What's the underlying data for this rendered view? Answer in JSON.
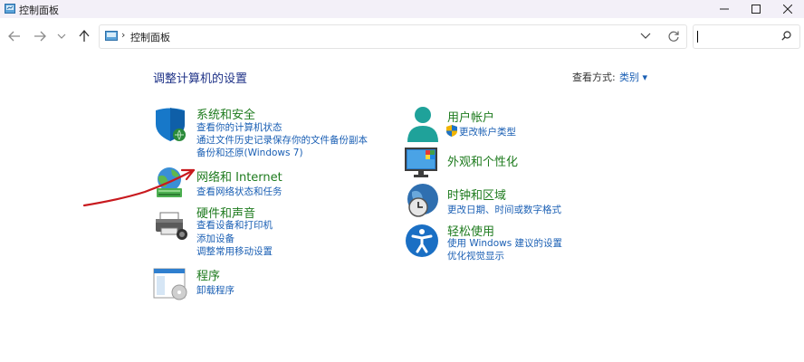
{
  "window": {
    "title": "控制面板"
  },
  "address": {
    "path": "控制面板",
    "separator": "›"
  },
  "search": {
    "placeholder": ""
  },
  "page": {
    "heading": "调整计算机的设置",
    "view_by_label": "查看方式:",
    "view_by_value": "类别 ▾"
  },
  "categories_left": [
    {
      "title": "系统和安全",
      "icon": "shield-icon",
      "links": [
        "查看你的计算机状态",
        "通过文件历史记录保存你的文件备份副本",
        "备份和还原(Windows 7)"
      ]
    },
    {
      "title": "网络和 Internet",
      "icon": "network-globe-icon",
      "links": [
        "查看网络状态和任务"
      ]
    },
    {
      "title": "硬件和声音",
      "icon": "printer-icon",
      "links": [
        "查看设备和打印机",
        "添加设备",
        "调整常用移动设置"
      ]
    },
    {
      "title": "程序",
      "icon": "programs-icon",
      "links": [
        "卸载程序"
      ]
    }
  ],
  "categories_right": [
    {
      "title": "用户帐户",
      "icon": "user-icon",
      "links": [
        "更改帐户类型"
      ]
    },
    {
      "title": "外观和个性化",
      "icon": "monitor-icon",
      "links": []
    },
    {
      "title": "时钟和区域",
      "icon": "clock-globe-icon",
      "links": [
        "更改日期、时间或数字格式"
      ]
    },
    {
      "title": "轻松使用",
      "icon": "accessibility-icon",
      "links": [
        "使用 Windows 建议的设置",
        "优化视觉显示"
      ]
    }
  ],
  "colors": {
    "link": "#1a5fb4",
    "category_title": "#1e7b1e",
    "heading": "#1e3287",
    "annotation": "#c8191e"
  }
}
